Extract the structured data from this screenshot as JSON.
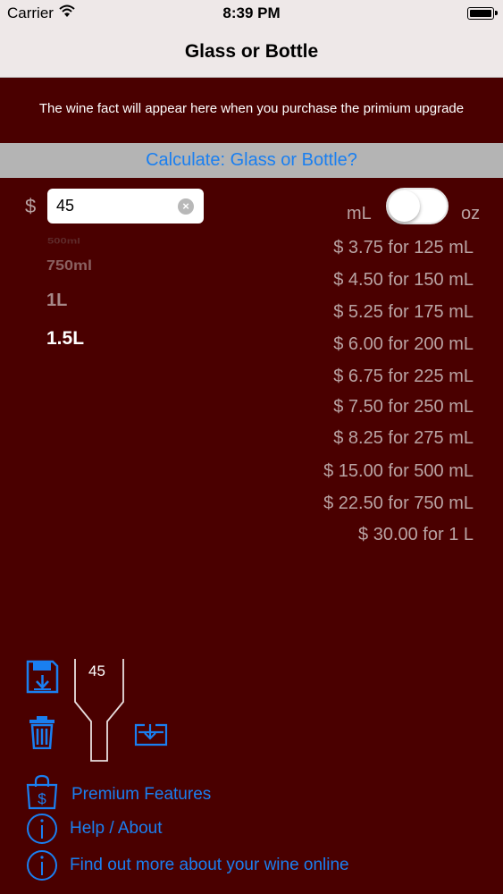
{
  "status_bar": {
    "carrier": "Carrier",
    "time": "8:39 PM"
  },
  "nav": {
    "title": "Glass or Bottle"
  },
  "fact_text": "The wine fact will appear here when you purchase the primium upgrade",
  "calc_button": "Calculate: Glass or Bottle?",
  "price": {
    "currency": "$",
    "value": "45"
  },
  "units": {
    "left": "mL",
    "right": "oz",
    "selected": "mL"
  },
  "bottle_sizes": [
    "500ml",
    "750ml",
    "1L",
    "1.5L"
  ],
  "results": [
    "$ 3.75 for 125 mL",
    "$ 4.50 for 150 mL",
    "$ 5.25 for 175 mL",
    "$ 6.00 for 200 mL",
    "$ 6.75 for 225 mL",
    "$ 7.50 for 250 mL",
    "$ 8.25 for 275 mL",
    "$ 15.00 for 500 mL",
    "$ 22.50 for 750 mL",
    "$ 30.00 for 1 L"
  ],
  "saved_bottle_value": "45",
  "links": {
    "premium": "Premium Features",
    "help": "Help / About",
    "online": "Find out more about your wine online"
  },
  "colors": {
    "background": "#4a0000",
    "accent": "#1a7ff0",
    "text_muted": "#b9a3a3",
    "bar": "#b4b4b4"
  },
  "icons": [
    "wifi-icon",
    "battery-icon",
    "clear-icon",
    "save-icon",
    "trash-icon",
    "bottle-icon",
    "load-icon",
    "shopping-bag-dollar-icon",
    "info-icon"
  ]
}
